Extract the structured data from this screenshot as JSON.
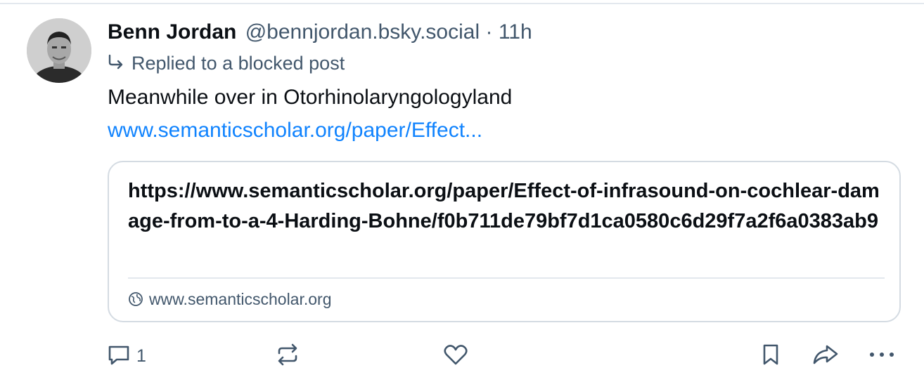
{
  "post": {
    "author_name": "Benn Jordan",
    "handle": "@bennjordan.bsky.social",
    "separator": "·",
    "time": "11h",
    "reply_note": "Replied to a blocked post",
    "text": "Meanwhile over in Otorhinolaryngologyland",
    "link_text": "www.semanticscholar.org/paper/Effect..."
  },
  "card": {
    "title": "https://www.semanticscholar.org/paper/Effect-of-infrasound-on-cochlear-damage-from-to-a-4-Harding-Bohne/f0b711de79bf7d1ca0580c6d29f7a2f6a0383ab9",
    "domain": "www.semanticscholar.org"
  },
  "actions": {
    "reply_count": "1",
    "icons": [
      "reply-icon",
      "repost-icon",
      "like-icon",
      "bookmark-icon",
      "share-icon",
      "more-icon"
    ]
  },
  "colors": {
    "link": "#1083fe",
    "muted": "#42576c",
    "border": "#d4dbe2"
  }
}
